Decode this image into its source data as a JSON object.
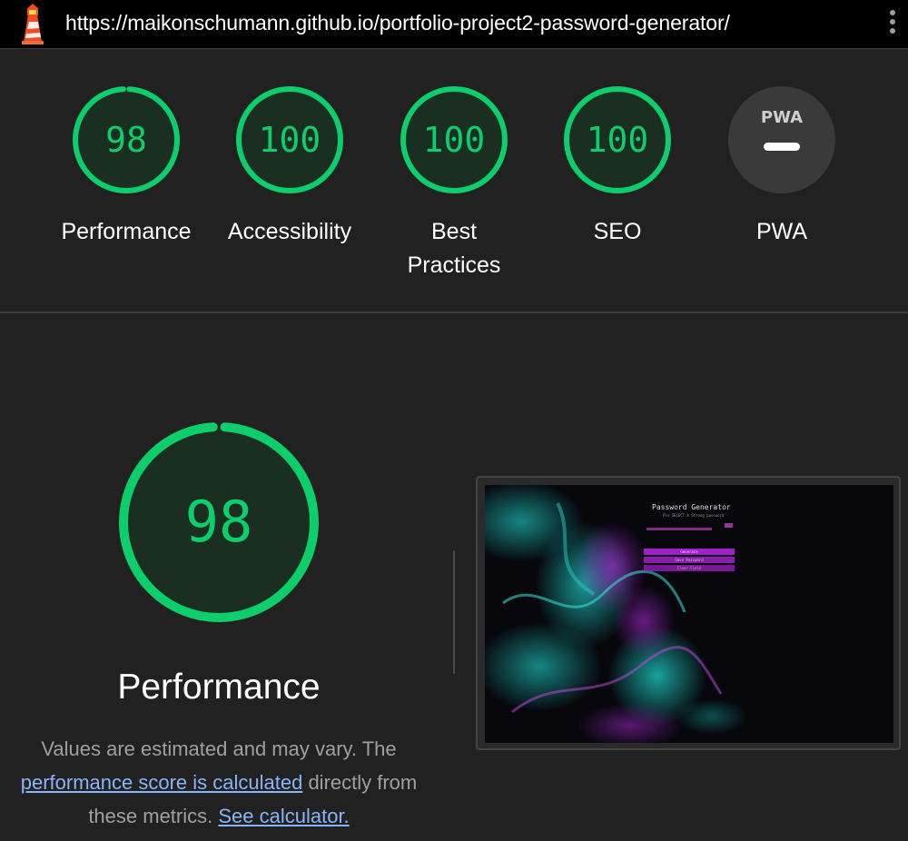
{
  "browser": {
    "url": "https://maikonschumann.github.io/portfolio-project2-password-generator/",
    "logo_icon": "lighthouse-icon",
    "menu_icon": "kebab-menu-icon"
  },
  "colors": {
    "pass": "#0cce6b",
    "pass_fill": "#1a2e22",
    "pwa": "#3a3a3a",
    "link": "#8ab4f8"
  },
  "categories": [
    {
      "id": "performance",
      "score": "98",
      "label": "Performance"
    },
    {
      "id": "accessibility",
      "score": "100",
      "label": "Accessibility"
    },
    {
      "id": "best-practices",
      "score": "100",
      "label": "Best Practices"
    },
    {
      "id": "seo",
      "score": "100",
      "label": "SEO"
    },
    {
      "id": "pwa",
      "score": "",
      "badge": "PWA",
      "label": "PWA"
    }
  ],
  "performance": {
    "score": "98",
    "title": "Performance",
    "desc_before": "Values are estimated and may vary. The ",
    "desc_link1": "performance score is calculated",
    "desc_middle": " directly from these metrics. ",
    "desc_link2": "See calculator."
  },
  "screenshot": {
    "title": "Password Generator",
    "subtitle": "Pls SELECT A Strong password",
    "button_1": "Generate",
    "button_2": "Save Password",
    "button_3": "Clear Field"
  }
}
